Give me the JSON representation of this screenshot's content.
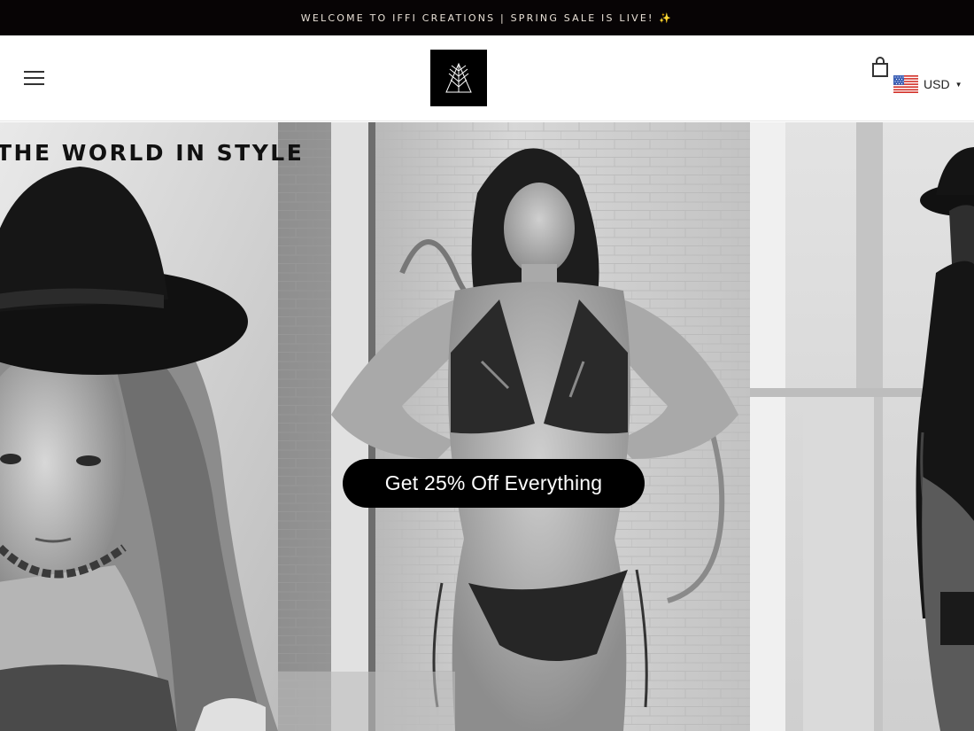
{
  "announcement": {
    "text": "WELCOME TO IFFI CREATIONS | SPRING SALE IS LIVE! ✨"
  },
  "header": {
    "menu_icon": "hamburger-menu-icon",
    "logo_icon": "brand-logo-mark",
    "cart_icon": "shopping-bag-icon",
    "currency": {
      "code": "USD",
      "flag_icon": "us-flag-icon",
      "caret_icon": "caret-down-icon"
    }
  },
  "hero": {
    "heading": "THE WORLD IN STYLE",
    "cta_label": "Get 25% Off Everything"
  },
  "colors": {
    "announcement_bg": "#070405",
    "announcement_text": "#e8e0d6",
    "cta_bg": "#000000",
    "cta_text": "#ffffff"
  }
}
